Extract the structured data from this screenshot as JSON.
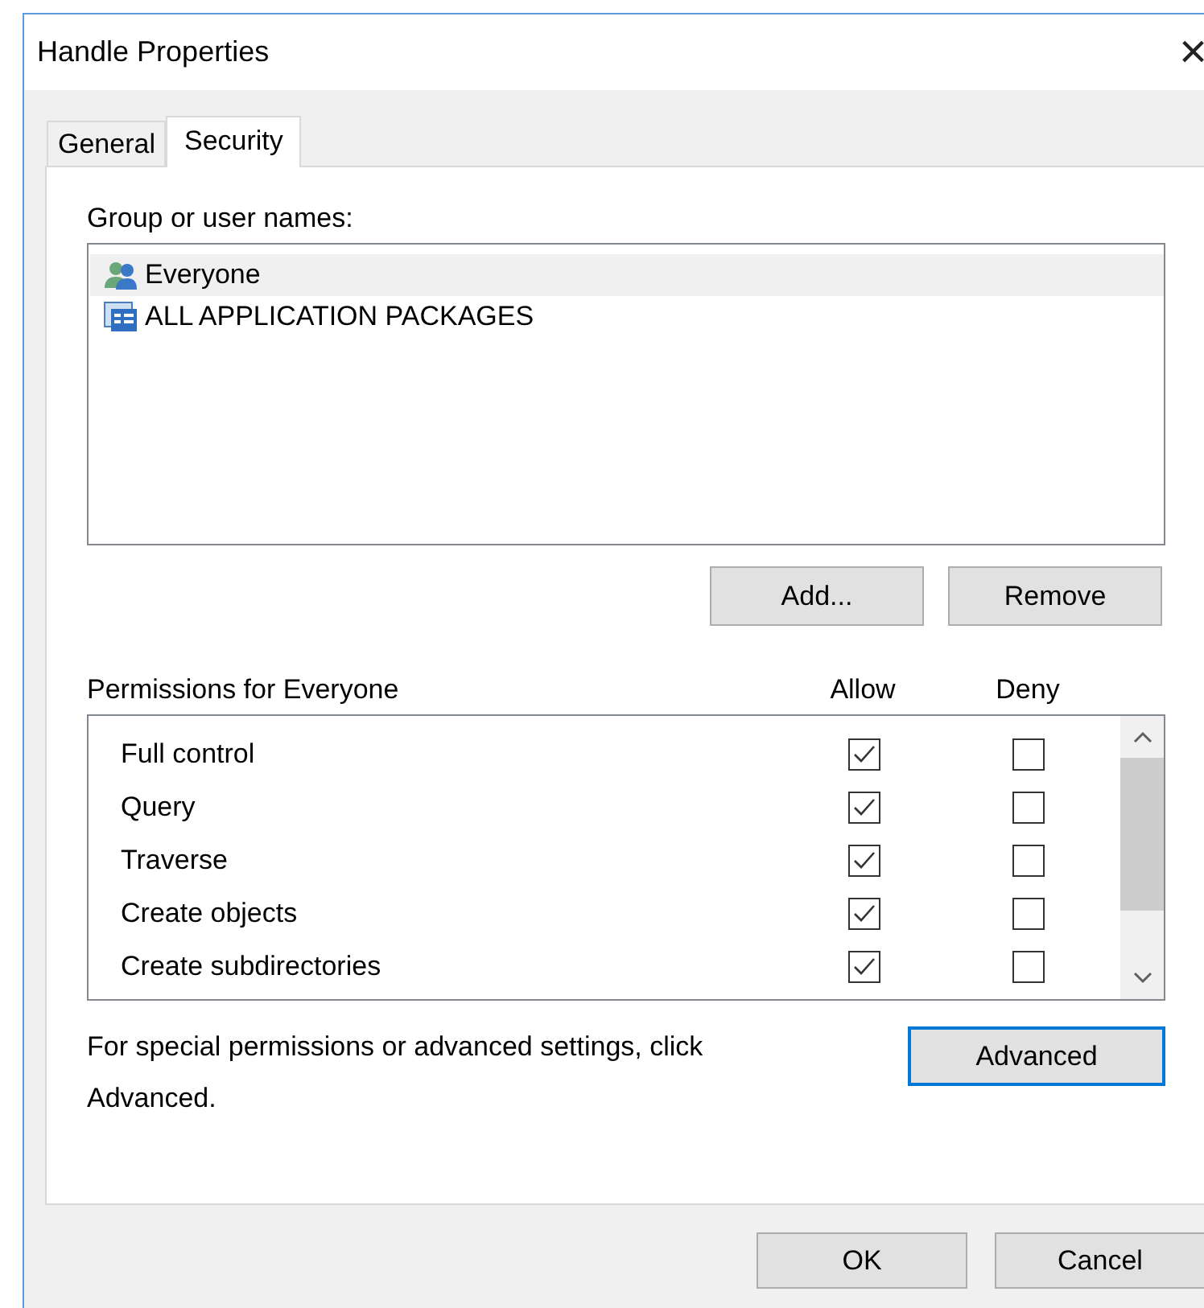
{
  "window": {
    "title": "Handle Properties",
    "close": "×"
  },
  "tabs": [
    {
      "label": "General",
      "selected": false
    },
    {
      "label": "Security",
      "selected": true
    }
  ],
  "group_label": "Group or user names:",
  "groups": [
    {
      "name": "Everyone",
      "kind": "group",
      "selected": true
    },
    {
      "name": "ALL APPLICATION PACKAGES",
      "kind": "package",
      "selected": false
    }
  ],
  "group_buttons": [
    "Add...",
    "Remove"
  ],
  "permissions_label": "Permissions for Everyone",
  "permission_columns": [
    "Allow",
    "Deny"
  ],
  "permissions": [
    {
      "name": "Full control",
      "allow": true,
      "deny": false
    },
    {
      "name": "Query",
      "allow": true,
      "deny": false
    },
    {
      "name": "Traverse",
      "allow": true,
      "deny": false
    },
    {
      "name": "Create objects",
      "allow": true,
      "deny": false
    },
    {
      "name": "Create subdirectories",
      "allow": true,
      "deny": false
    }
  ],
  "advanced_note": "For special permissions or advanced settings, click Advanced.",
  "advanced_button": "Advanced",
  "buttons": [
    "OK",
    "Cancel"
  ]
}
